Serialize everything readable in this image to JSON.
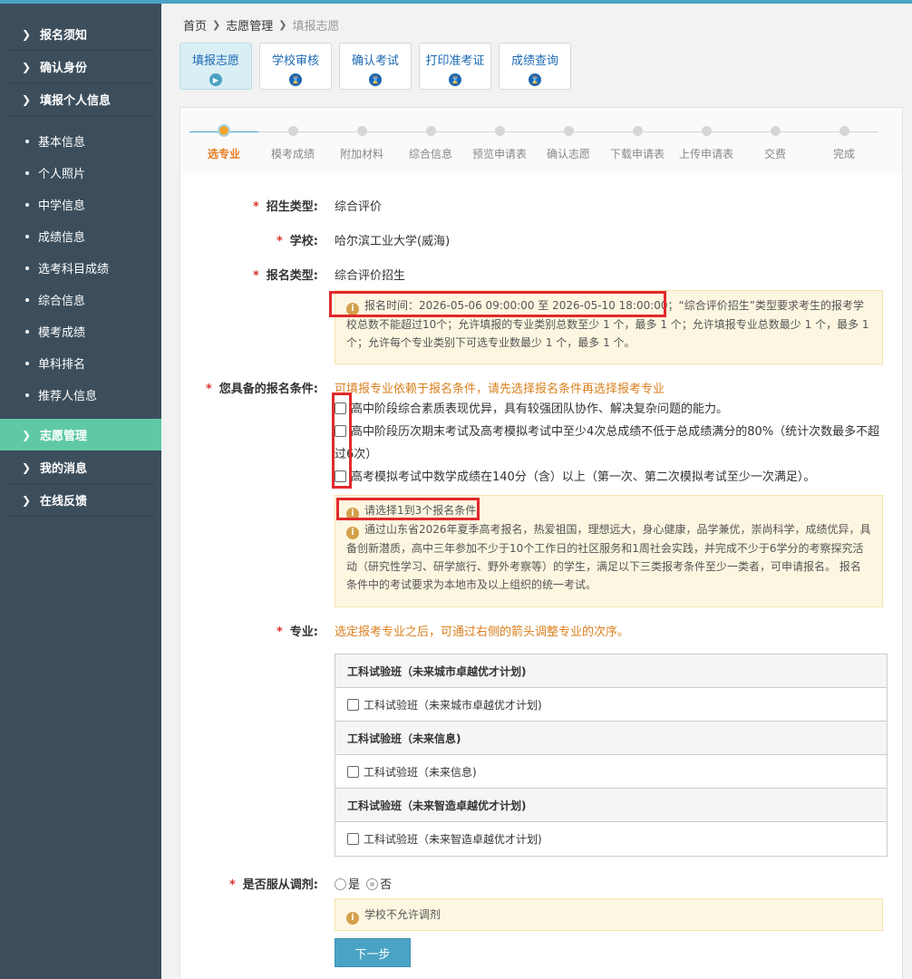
{
  "sidebar": {
    "top_items": [
      {
        "label": "报名须知"
      },
      {
        "label": "确认身份"
      },
      {
        "label": "填报个人信息"
      }
    ],
    "sub_items": [
      {
        "label": "基本信息"
      },
      {
        "label": "个人照片"
      },
      {
        "label": "中学信息"
      },
      {
        "label": "成绩信息"
      },
      {
        "label": "选考科目成绩"
      },
      {
        "label": "综合信息"
      },
      {
        "label": "模考成绩"
      },
      {
        "label": "单科排名"
      },
      {
        "label": "推荐人信息"
      }
    ],
    "bottom_items": [
      {
        "label": "志愿管理",
        "active": true
      },
      {
        "label": "我的消息"
      },
      {
        "label": "在线反馈"
      }
    ]
  },
  "breadcrumb": {
    "home": "首页",
    "section": "志愿管理",
    "current": "填报志愿"
  },
  "tabs": [
    {
      "label": "填报志愿",
      "active": true
    },
    {
      "label": "学校审核"
    },
    {
      "label": "确认考试"
    },
    {
      "label": "打印准考证"
    },
    {
      "label": "成绩查询"
    }
  ],
  "steps": [
    {
      "label": "选专业",
      "active": true
    },
    {
      "label": "模考成绩"
    },
    {
      "label": "附加材料"
    },
    {
      "label": "综合信息"
    },
    {
      "label": "预览申请表"
    },
    {
      "label": "确认志愿"
    },
    {
      "label": "下载申请表"
    },
    {
      "label": "上传申请表"
    },
    {
      "label": "交费"
    },
    {
      "label": "完成"
    }
  ],
  "form": {
    "required_mark": "*",
    "enroll_type": {
      "label": "招生类型:",
      "value": "综合评价"
    },
    "school": {
      "label": "学校:",
      "value": "哈尔滨工业大学(威海)"
    },
    "apply_type": {
      "label": "报名类型:",
      "value": "综合评价招生"
    },
    "time_note": {
      "time": "报名时间：2026-05-06 09:00:00 至 2026-05-10 18:00:00；",
      "rest": "“综合评价招生”类型要求考生的报考学校总数不能超过10个；允许填报的专业类别总数至少 1 个，最多 1 个；允许填报专业总数最少 1 个，最多 1 个；允许每个专业类别下可选专业数最少 1 个，最多 1 个。"
    },
    "conditions": {
      "label": "您具备的报名条件:",
      "hint": "可填报专业依赖于报名条件，请先选择报名条件再选择报考专业",
      "items": [
        {
          "label": "高中阶段综合素质表现优异，具有较强团队协作、解决复杂问题的能力。"
        },
        {
          "label": "高中阶段历次期末考试及高考模拟考试中至少4次总成绩不低于总成绩满分的80%（统计次数最多不超过6次）"
        },
        {
          "label": "高考模拟考试中数学成绩在140分（含）以上（第一次、第二次模拟考试至少一次满足）。"
        }
      ],
      "note_title": "请选择1到3个报名条件",
      "note_body": "通过山东省2026年夏季高考报名，热爱祖国，理想远大，身心健康，品学兼优，崇尚科学，成绩优异，具备创新潜质，高中三年参加不少于10个工作日的社区服务和1周社会实践，并完成不少于6学分的考察探究活动（研究性学习、研学旅行、野外考察等）的学生，满足以下三类报考条件至少一类者，可申请报名。 报名条件中的考试要求为本地市及以上组织的统一考试。"
    },
    "major": {
      "label": "专业:",
      "hint": "选定报考专业之后，可通过右侧的箭头调整专业的次序。",
      "groups": [
        {
          "title": "工科试验班（未来城市卓越优才计划)",
          "item": "工科试验班（未来城市卓越优才计划)"
        },
        {
          "title": "工科试验班（未来信息)",
          "item": "工科试验班（未来信息)"
        },
        {
          "title": "工科试验班（未来智造卓越优才计划)",
          "item": "工科试验班（未来智造卓越优才计划)"
        }
      ]
    },
    "adjust": {
      "label": "是否服从调剂:",
      "yes": "是",
      "no": "否",
      "selected": "否",
      "note": "学校不允许调剂"
    },
    "next_button": "下一步"
  }
}
